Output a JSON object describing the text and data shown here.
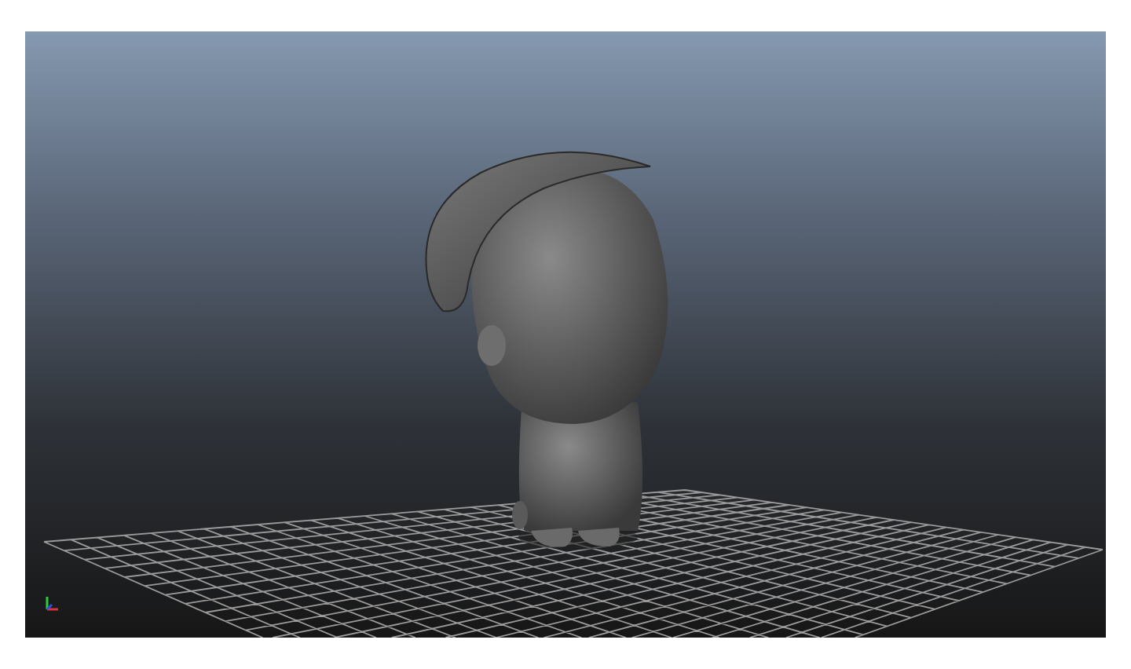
{
  "viewport": {
    "grid": true,
    "axis_gizmo": true
  }
}
